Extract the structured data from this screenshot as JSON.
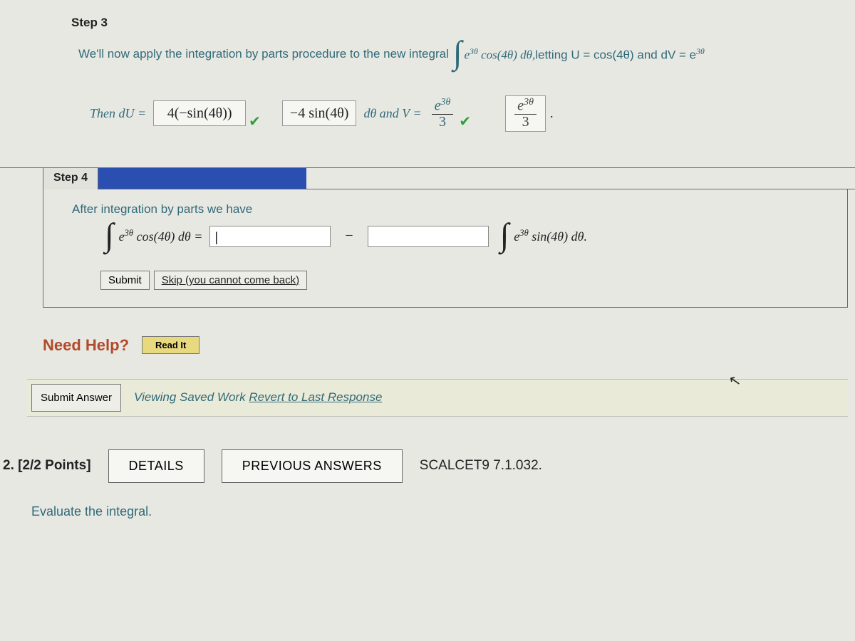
{
  "step3": {
    "label": "Step 3",
    "intro_pre": "We'll now apply the integration by parts procedure to the new integral",
    "intro_int_expr": "e",
    "intro_int_sup": "3θ",
    "intro_int_rest": " cos(4θ) dθ,",
    "intro_post": " letting U = cos(4θ) and dV = e",
    "intro_post_sup": "3θ",
    "then_du": "Then dU =",
    "du_value": "4(−sin(4θ))",
    "dtheta_text": "dθ and V =",
    "v_box": "−4 sin(4θ)",
    "frac1_num": "e",
    "frac1_num_sup": "3θ",
    "frac1_den": "3",
    "frac2_num": "e",
    "frac2_num_sup": "3θ",
    "frac2_den": "3"
  },
  "step4": {
    "tab": "Step 4",
    "text": "After integration by parts we have",
    "lhs_e": "e",
    "lhs_sup": "3θ",
    "lhs_rest": " cos(4θ) dθ =",
    "minus": "−",
    "rhs_e": "e",
    "rhs_sup": "3θ",
    "rhs_rest": " sin(4θ) dθ.",
    "submit": "Submit",
    "skip": "Skip (you cannot come back)"
  },
  "help": {
    "label": "Need Help?",
    "read": "Read It"
  },
  "saved": {
    "submit": "Submit Answer",
    "viewing": "Viewing Saved Work ",
    "revert": "Revert to Last Response"
  },
  "q2": {
    "num": "2. [2/2 Points]",
    "details": "DETAILS",
    "prev": "PREVIOUS ANSWERS",
    "src": "SCALCET9 7.1.032.",
    "eval": "Evaluate the integral."
  }
}
